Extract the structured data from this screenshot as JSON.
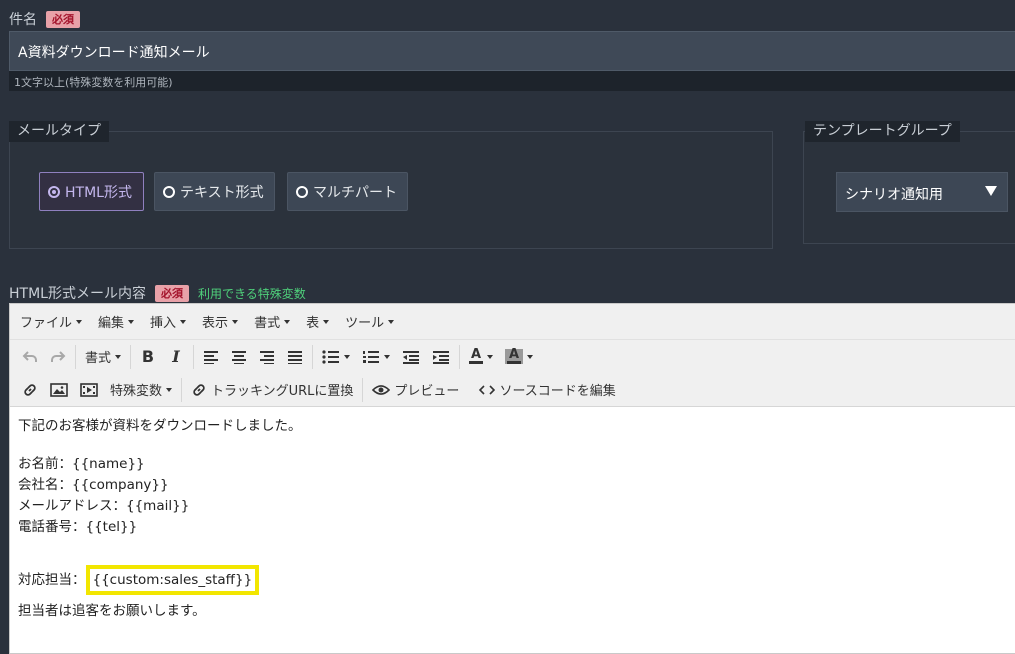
{
  "subject": {
    "label": "件名",
    "required_badge": "必須",
    "value": "A資料ダウンロード通知メール",
    "hint": "1文字以上(特殊変数を利用可能)"
  },
  "mail_type": {
    "legend": "メールタイプ",
    "options": [
      "HTML形式",
      "テキスト形式",
      "マルチパート"
    ],
    "selected": "HTML形式"
  },
  "template_group": {
    "legend": "テンプレートグループ",
    "selected": "シナリオ通知用"
  },
  "html_content": {
    "label": "HTML形式メール内容",
    "required_badge": "必須",
    "link": "利用できる特殊変数"
  },
  "editor": {
    "menu": [
      "ファイル",
      "編集",
      "挿入",
      "表示",
      "書式",
      "表",
      "ツール"
    ],
    "toolbar": {
      "format": "書式",
      "special_vars": "特殊変数",
      "tracking": "トラッキングURLに置換",
      "preview": "プレビュー",
      "source": "ソースコードを編集"
    },
    "body": {
      "line1": "下記のお客様が資料をダウンロードしました。",
      "line2": "お名前：{{name}}",
      "line3": "会社名：{{company}}",
      "line4": "メールアドレス：{{mail}}",
      "line5": "電話番号：{{tel}}",
      "staff_label": "対応担当：",
      "staff_var": "{{custom:sales_staff}}",
      "line7": "担当者は追客をお願いします。"
    }
  },
  "colors": {
    "background": "#2a313c",
    "accent_purple": "#c4b7ee",
    "required_bg": "#e8a1a8",
    "required_text": "#a3132b",
    "link_green": "#4fd17b",
    "highlight_yellow": "#f2e600"
  }
}
